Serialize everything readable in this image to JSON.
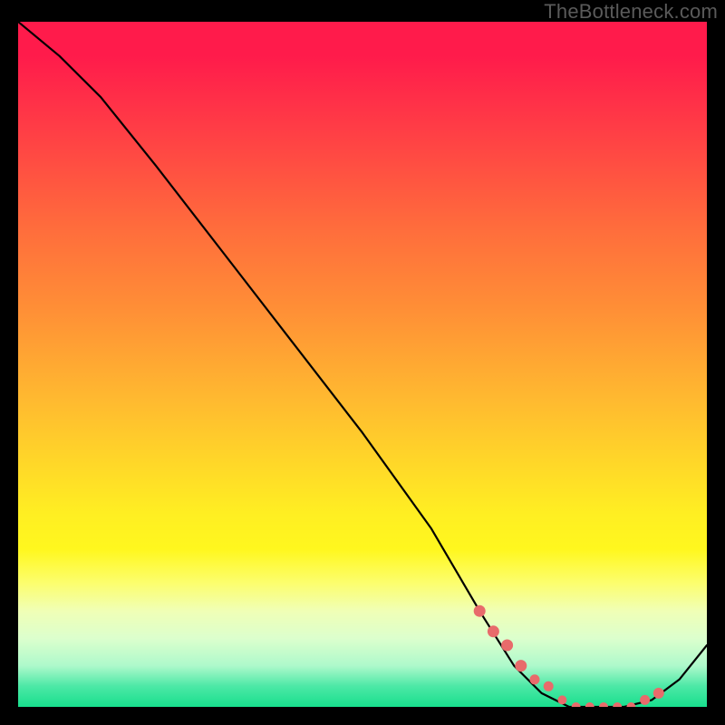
{
  "attribution": "TheBottleneck.com",
  "colors": {
    "gradient_top": "#ff1b4b",
    "gradient_bottom": "#18df8d",
    "curve": "#000000",
    "dots": "#e86b6b",
    "frame": "#000000"
  },
  "chart_data": {
    "type": "line",
    "title": "",
    "xlabel": "",
    "ylabel": "",
    "xlim": [
      0,
      100
    ],
    "ylim": [
      0,
      100
    ],
    "grid": false,
    "legend": false,
    "annotations": [
      "TheBottleneck.com"
    ],
    "series": [
      {
        "name": "curve",
        "x": [
          0,
          6,
          12,
          20,
          30,
          40,
          50,
          60,
          67,
          72,
          76,
          80,
          84,
          88,
          92,
          96,
          100
        ],
        "y": [
          100,
          95,
          89,
          79,
          66,
          53,
          40,
          26,
          14,
          6,
          2,
          0,
          0,
          0,
          1,
          4,
          9
        ]
      }
    ],
    "highlight_dots": {
      "name": "dots",
      "x": [
        67,
        69,
        71,
        73,
        75,
        77,
        79,
        81,
        83,
        85,
        87,
        89,
        91,
        93
      ],
      "y": [
        14,
        11,
        9,
        6,
        4,
        3,
        1,
        0,
        0,
        0,
        0,
        0,
        1,
        2
      ],
      "r": [
        6,
        6,
        6,
        6,
        5,
        5,
        4.5,
        4.5,
        4.5,
        4.5,
        4.5,
        4.5,
        5,
        5.5
      ]
    }
  }
}
